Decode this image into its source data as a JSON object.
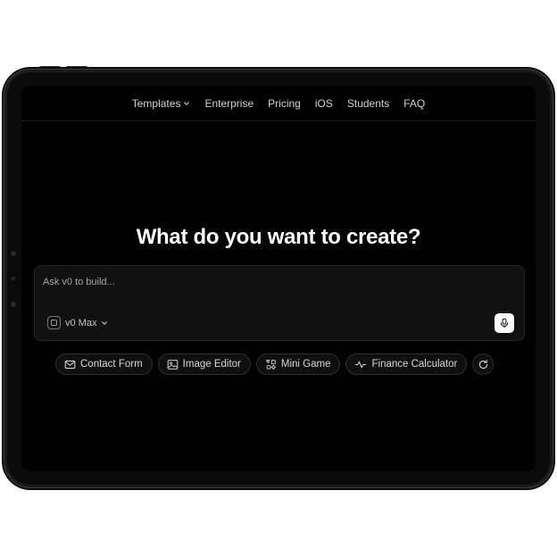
{
  "nav": {
    "items": [
      {
        "label": "Templates",
        "has_dropdown": true
      },
      {
        "label": "Enterprise"
      },
      {
        "label": "Pricing"
      },
      {
        "label": "iOS"
      },
      {
        "label": "Students"
      },
      {
        "label": "FAQ"
      }
    ]
  },
  "hero": {
    "title": "What do you want to create?"
  },
  "prompt": {
    "placeholder": "Ask v0 to build...",
    "value": "",
    "model_label": "v0 Max"
  },
  "suggestions": [
    {
      "label": "Contact Form",
      "icon": "mail-icon"
    },
    {
      "label": "Image Editor",
      "icon": "image-icon"
    },
    {
      "label": "Mini Game",
      "icon": "shapes-icon"
    },
    {
      "label": "Finance Calculator",
      "icon": "activity-icon"
    }
  ],
  "colors": {
    "screen_background": "#000000",
    "device_frame": "#1b1b1d",
    "mic_button": "#ffffff"
  }
}
